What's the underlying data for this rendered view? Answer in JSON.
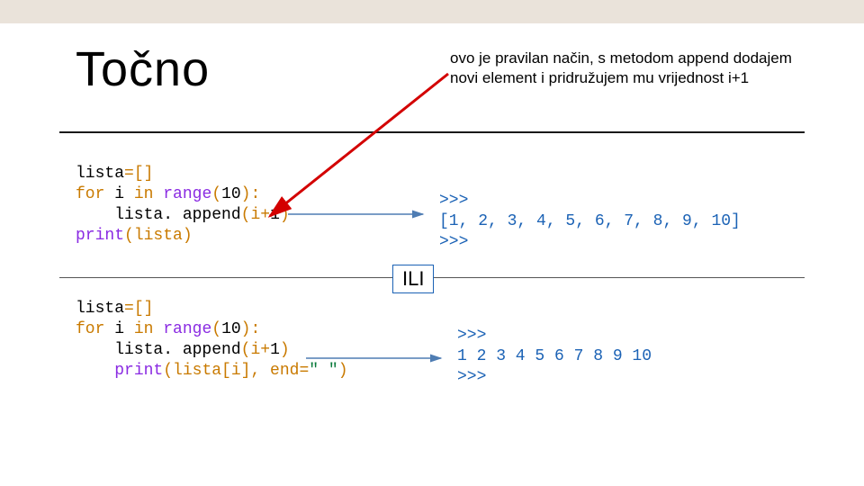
{
  "title": "Točno",
  "note": "ovo je pravilan način, s metodom append dodajem novi element i pridružujem mu vrijednost i+1",
  "divider_label": "ILI",
  "code1": {
    "l1a": "lista",
    "l1b": "=[]",
    "l2a": "for ",
    "l2b": "i ",
    "l2c": "in ",
    "l2d": "range",
    "l2e": "(",
    "l2f": "10",
    "l2g": "):",
    "l3a": "    lista. append",
    "l3b": "(i",
    "l3c": "+",
    "l3d": "1",
    "l3e": ")",
    "l4a": "print",
    "l4b": "(lista)"
  },
  "code2": {
    "l1a": "lista",
    "l1b": "=[]",
    "l2a": "for ",
    "l2b": "i ",
    "l2c": "in ",
    "l2d": "range",
    "l2e": "(",
    "l2f": "10",
    "l2g": "):",
    "l3a": "    lista. append",
    "l3b": "(i",
    "l3c": "+",
    "l3d": "1",
    "l3e": ")",
    "l4a": "    ",
    "l4b": "print",
    "l4c": "(lista[i], end",
    "l4d": "=",
    "l4e": "\" \"",
    "l4f": ")"
  },
  "out1": {
    "l1": ">>>",
    "l2": "[1, 2, 3, 4, 5, 6, 7, 8, 9, 10]",
    "l3": ">>>"
  },
  "out2": {
    "l1": ">>>",
    "l2": "1 2 3 4 5 6 7 8 9 10",
    "l3": ">>>"
  }
}
